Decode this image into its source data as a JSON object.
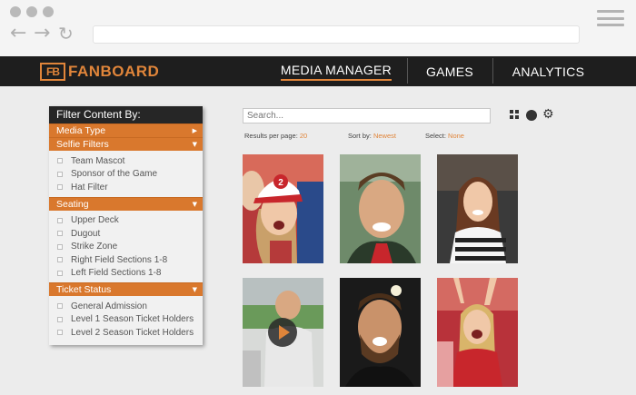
{
  "app": {
    "logo_mark": "FB",
    "logo_text": "FANBOARD",
    "nav": [
      "MEDIA MANAGER",
      "GAMES",
      "ANALYTICS"
    ]
  },
  "filters": {
    "title": "Filter Content By:",
    "media_type": "Media Type",
    "selfie": {
      "label": "Selfie Filters",
      "items": [
        "Team Mascot",
        "Sponsor of the Game",
        "Hat Filter"
      ]
    },
    "seating": {
      "label": "Seating",
      "items": [
        "Upper Deck",
        "Dugout",
        "Strike Zone",
        "Right Field Sections 1-8",
        "Left Field Sections 1-8"
      ]
    },
    "ticket": {
      "label": "Ticket Status",
      "items": [
        "General Admission",
        "Level 1 Season Ticket Holders",
        "Level 2 Season Ticket Holders"
      ]
    }
  },
  "search": {
    "placeholder": "Search..."
  },
  "toolbar": {
    "results_label": "Results per page:",
    "results_value": "20",
    "sort_label": "Sort by:",
    "sort_value": "Newest",
    "select_label": "Select:",
    "select_value": "None"
  },
  "icons": {
    "grid": "grid-view-icon",
    "circle": "circle-icon",
    "gear": "gear-icon",
    "play": "play-icon"
  },
  "photos": [
    {
      "kind": "photo",
      "hat_number": "2"
    },
    {
      "kind": "photo"
    },
    {
      "kind": "photo"
    },
    {
      "kind": "video"
    },
    {
      "kind": "photo"
    },
    {
      "kind": "photo"
    }
  ],
  "colors": {
    "accent": "#e0853a",
    "appbar": "#1e1e1e",
    "section": "#d9782d"
  }
}
